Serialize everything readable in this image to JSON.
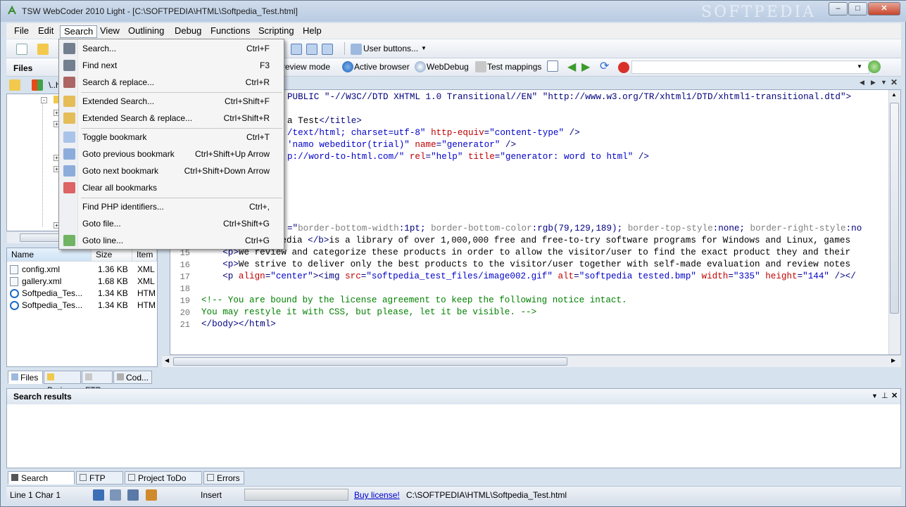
{
  "window": {
    "title": "TSW WebCoder 2010 Light - [C:\\SOFTPEDIA\\HTML\\Softpedia_Test.html]",
    "watermark": "SOFTPEDIA",
    "minimize": "–",
    "maximize": "□",
    "close": "✕"
  },
  "menubar": {
    "items": [
      "File",
      "Edit",
      "Search",
      "View",
      "Outlining",
      "Debug",
      "Functions",
      "Scripting",
      "Help"
    ]
  },
  "toolbar": {
    "user_buttons": "User buttons...",
    "preview_mode": "review mode",
    "active_browser": "Active browser",
    "webdebug": "WebDebug",
    "test_mappings": "Test mappings"
  },
  "files_panel": {
    "title": "Files",
    "path_stub": "\\..h",
    "columns": [
      "Name",
      "Size",
      "Item"
    ],
    "files": [
      {
        "name": "config.xml",
        "size": "1.36 KB",
        "type": "XML"
      },
      {
        "name": "gallery.xml",
        "size": "1.68 KB",
        "type": "XML"
      },
      {
        "name": "Softpedia_Tes...",
        "size": "1.34 KB",
        "type": "HTM"
      },
      {
        "name": "Softpedia_Tes...",
        "size": "1.34 KB",
        "type": "HTM"
      }
    ]
  },
  "search_menu": {
    "items": [
      {
        "label": "Search...",
        "shortcut": "Ctrl+F",
        "icon": "binoculars-icon"
      },
      {
        "label": "Find next",
        "shortcut": "F3",
        "icon": "find-next-icon"
      },
      {
        "label": "Search & replace...",
        "shortcut": "Ctrl+R",
        "icon": "search-replace-icon"
      },
      {
        "label": "Extended Search...",
        "shortcut": "Ctrl+Shift+F",
        "icon": "folder-search-icon"
      },
      {
        "label": "Extended Search & replace...",
        "shortcut": "Ctrl+Shift+R",
        "icon": "folder-replace-icon"
      },
      {
        "label": "Toggle bookmark",
        "shortcut": "Ctrl+T",
        "icon": "bookmark-icon"
      },
      {
        "label": "Goto previous bookmark",
        "shortcut": "Ctrl+Shift+Up Arrow",
        "icon": "prev-bookmark-icon"
      },
      {
        "label": "Goto next bookmark",
        "shortcut": "Ctrl+Shift+Down Arrow",
        "icon": "next-bookmark-icon"
      },
      {
        "label": "Clear all bookmarks",
        "shortcut": "",
        "icon": "clear-bookmarks-icon"
      },
      {
        "label": "Find PHP identifiers...",
        "shortcut": "Ctrl+,",
        "icon": ""
      },
      {
        "label": "Goto file...",
        "shortcut": "Ctrl+Shift+G",
        "icon": ""
      },
      {
        "label": "Goto line...",
        "shortcut": "Ctrl+G",
        "icon": "goto-line-icon"
      }
    ]
  },
  "editor": {
    "lines": [
      {
        "n": "",
        "segs": [
          {
            "c": "tag",
            "t": "PUBLIC \"-//W3C//DTD XHTML 1.0 Transitional//EN\" \"http://www.w3.org/TR/xhtml1/DTD/xhtml1-transitional.dtd\">"
          }
        ]
      },
      {
        "n": "",
        "segs": []
      },
      {
        "n": "",
        "segs": [
          {
            "c": "txt",
            "t": "a Test"
          },
          {
            "c": "tag",
            "t": "</title>"
          }
        ]
      },
      {
        "n": "",
        "segs": [
          {
            "c": "val",
            "t": "/text/html; charset=utf-8\" "
          },
          {
            "c": "attr",
            "t": "http-equiv"
          },
          {
            "c": "tag",
            "t": "="
          },
          {
            "c": "val",
            "t": "\"content-type\" "
          },
          {
            "c": "tag",
            "t": "/>"
          }
        ]
      },
      {
        "n": "",
        "segs": [
          {
            "c": "val",
            "t": "'namo webeditor(trial)\" "
          },
          {
            "c": "attr",
            "t": "name"
          },
          {
            "c": "tag",
            "t": "="
          },
          {
            "c": "val",
            "t": "\"generator\" "
          },
          {
            "c": "tag",
            "t": "/>"
          }
        ]
      },
      {
        "n": "",
        "segs": [
          {
            "c": "val",
            "t": "p://word-to-html.com/\" "
          },
          {
            "c": "attr",
            "t": "rel"
          },
          {
            "c": "tag",
            "t": "="
          },
          {
            "c": "val",
            "t": "\"help\" "
          },
          {
            "c": "attr",
            "t": "title"
          },
          {
            "c": "tag",
            "t": "="
          },
          {
            "c": "val",
            "t": "\"generator: word to html\" "
          },
          {
            "c": "tag",
            "t": "/>"
          }
        ]
      },
      {
        "n": "",
        "segs": []
      },
      {
        "n": "",
        "segs": []
      },
      {
        "n": "",
        "segs": []
      },
      {
        "n": "",
        "segs": []
      },
      {
        "n": "",
        "segs": []
      },
      {
        "n": "",
        "segs": [
          {
            "c": "tag",
            "t": "=\""
          },
          {
            "c": "css",
            "t": "border-bottom-width"
          },
          {
            "c": "tag",
            "t": ":1pt; "
          },
          {
            "c": "css",
            "t": "border-bottom-color"
          },
          {
            "c": "tag",
            "t": ":rgb(79,129,189); "
          },
          {
            "c": "css",
            "t": "border-top-style"
          },
          {
            "c": "tag",
            "t": ":none; "
          },
          {
            "c": "css",
            "t": "border-right-style"
          },
          {
            "c": "tag",
            "t": ":no"
          }
        ]
      },
      {
        "n": "14",
        "segs": [
          {
            "c": "txt",
            "t": "    "
          },
          {
            "c": "tag",
            "t": "<p><b>"
          },
          {
            "c": "txt",
            "t": "Softpedia "
          },
          {
            "c": "tag",
            "t": "</b>"
          },
          {
            "c": "txt",
            "t": "is a library of over 1,000,000 free and free-to-try software programs for Windows and Linux, games"
          }
        ]
      },
      {
        "n": "15",
        "segs": [
          {
            "c": "txt",
            "t": "    "
          },
          {
            "c": "tag",
            "t": "<p>"
          },
          {
            "c": "txt",
            "t": "We review and categorize these products in order to allow the visitor/user to find the exact product they and their"
          }
        ]
      },
      {
        "n": "16",
        "segs": [
          {
            "c": "txt",
            "t": "    "
          },
          {
            "c": "tag",
            "t": "<p>"
          },
          {
            "c": "txt",
            "t": "We strive to deliver only the best products to the visitor/user together with self-made evaluation and review notes"
          }
        ]
      },
      {
        "n": "17",
        "segs": [
          {
            "c": "txt",
            "t": "    "
          },
          {
            "c": "tag",
            "t": "<p "
          },
          {
            "c": "attr",
            "t": "align"
          },
          {
            "c": "tag",
            "t": "="
          },
          {
            "c": "val",
            "t": "\"center\""
          },
          {
            "c": "tag",
            "t": "><img "
          },
          {
            "c": "attr",
            "t": "src"
          },
          {
            "c": "tag",
            "t": "="
          },
          {
            "c": "val",
            "t": "\"softpedia_test_files/image002.gif\" "
          },
          {
            "c": "attr",
            "t": "alt"
          },
          {
            "c": "tag",
            "t": "="
          },
          {
            "c": "val",
            "t": "\"softpedia tested.bmp\" "
          },
          {
            "c": "attr",
            "t": "width"
          },
          {
            "c": "tag",
            "t": "="
          },
          {
            "c": "val",
            "t": "\"335\" "
          },
          {
            "c": "attr",
            "t": "height"
          },
          {
            "c": "tag",
            "t": "="
          },
          {
            "c": "val",
            "t": "\"144\" "
          },
          {
            "c": "tag",
            "t": "/></"
          }
        ]
      },
      {
        "n": "18",
        "segs": []
      },
      {
        "n": "19",
        "segs": [
          {
            "c": "comment",
            "t": "<!-- You are bound by the license agreement to keep the following notice intact."
          }
        ]
      },
      {
        "n": "20",
        "segs": [
          {
            "c": "comment",
            "t": "You may restyle it with CSS, but please, let it be visible. -->"
          }
        ]
      },
      {
        "n": "21",
        "segs": [
          {
            "c": "tag",
            "t": "</body></html>"
          }
        ]
      }
    ]
  },
  "left_tabs": [
    "Files",
    "Proj...",
    "FTP",
    "Cod..."
  ],
  "search_results": {
    "title": "Search results"
  },
  "bottom_tabs": [
    "Search results",
    "FTP Log",
    "Project ToDo list",
    "Errors"
  ],
  "statusbar": {
    "position": "Line 1 Char 1",
    "mode": "Insert",
    "buy_license": "Buy license!",
    "path": "C:\\SOFTPEDIA\\HTML\\Softpedia_Test.html"
  }
}
